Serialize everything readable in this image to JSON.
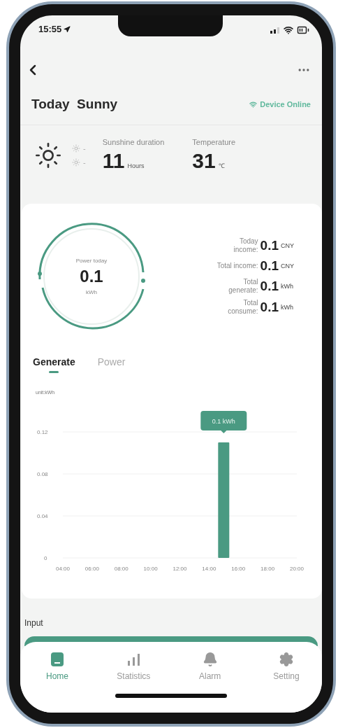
{
  "status_bar": {
    "time": "15:55"
  },
  "header": {
    "title": "Today  Sunny",
    "device_status": "Device Online"
  },
  "weather": {
    "minor": [
      {
        "value": "-"
      },
      {
        "value": "-"
      }
    ],
    "stats": [
      {
        "label": "Sunshine duration",
        "value": "11",
        "unit": "Hours"
      },
      {
        "label": "Temperature",
        "value": "31",
        "unit": "℃"
      }
    ]
  },
  "summary": {
    "gauge": {
      "label": "Power today",
      "value": "0.1",
      "unit": "kWh"
    },
    "rows": [
      {
        "label": "Today income:",
        "value": "0.1",
        "unit": "CNY"
      },
      {
        "label": "Total income:",
        "value": "0.1",
        "unit": "CNY"
      },
      {
        "label": "Total generate:",
        "value": "0.1",
        "unit": "kWh"
      },
      {
        "label": "Total consume:",
        "value": "0.1",
        "unit": "kWh"
      }
    ]
  },
  "tabs": [
    {
      "label": "Generate",
      "selected": true
    },
    {
      "label": "Power",
      "selected": false
    }
  ],
  "chart": {
    "unit_label": "unit:kWh",
    "tooltip": "0.1 kWh",
    "chart_data": {
      "type": "bar",
      "x": [
        15
      ],
      "series": [
        {
          "color": "#4a9a82",
          "values": [
            0.11
          ]
        }
      ],
      "xlim": [
        4,
        20
      ],
      "ylim": [
        0,
        0.12
      ],
      "xticks": [
        {
          "value": 4,
          "label": "04:00"
        },
        {
          "value": 6,
          "label": "06:00"
        },
        {
          "value": 8,
          "label": "08:00"
        },
        {
          "value": 10,
          "label": "10:00"
        },
        {
          "value": 12,
          "label": "12:00"
        },
        {
          "value": 14,
          "label": "14:00"
        },
        {
          "value": 16,
          "label": "16:00"
        },
        {
          "value": 18,
          "label": "18:00"
        },
        {
          "value": 20,
          "label": "20:00"
        }
      ],
      "yticks": [
        0,
        0.04,
        0.08,
        0.12
      ]
    }
  },
  "section": {
    "title": "Input"
  },
  "nav": [
    {
      "kind": "home",
      "label": "Home",
      "selected": true
    },
    {
      "kind": "stats",
      "label": "Statistics",
      "selected": false
    },
    {
      "kind": "alarm",
      "label": "Alarm",
      "selected": false
    },
    {
      "kind": "settings",
      "label": "Setting",
      "selected": false
    }
  ]
}
